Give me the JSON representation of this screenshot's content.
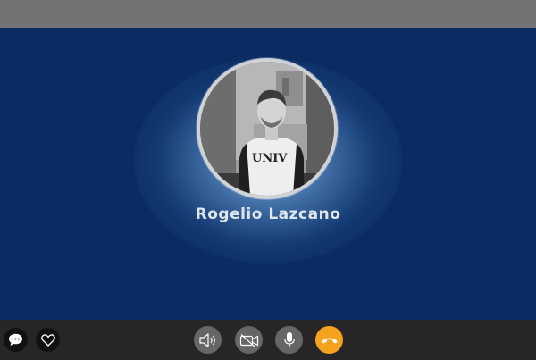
{
  "call": {
    "caller_name": "Rogelio Lazcano"
  },
  "controls": {
    "left": [
      {
        "name": "chat",
        "icon": "chat-bubble-icon"
      },
      {
        "name": "favorite",
        "icon": "heart-icon"
      }
    ],
    "center": [
      {
        "name": "speaker",
        "icon": "speaker-icon"
      },
      {
        "name": "video",
        "icon": "video-off-icon"
      },
      {
        "name": "microphone",
        "icon": "microphone-icon"
      },
      {
        "name": "end-call",
        "icon": "hang-up-icon"
      }
    ]
  },
  "colors": {
    "title_bar": "#737375",
    "call_background": "#0a2c63",
    "control_bar": "#272525",
    "control_button": "#666666",
    "hangup_button": "#f5a21f",
    "name_text": "#dfe6f0"
  }
}
